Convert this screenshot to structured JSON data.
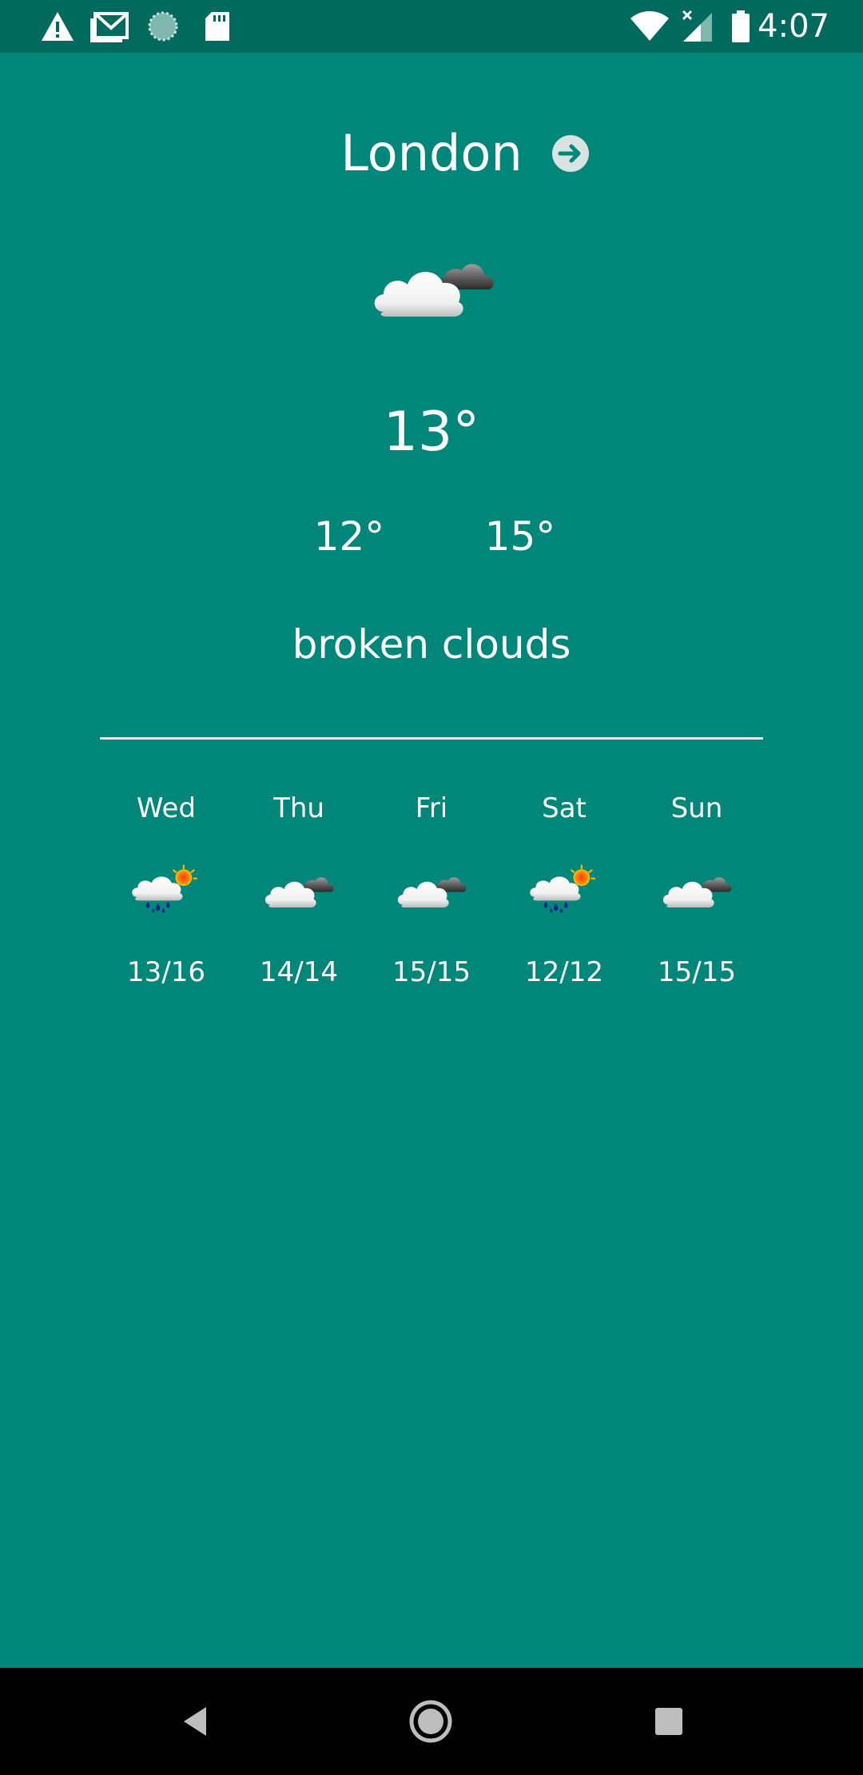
{
  "status_bar": {
    "time": "4:07",
    "left_icons": [
      "warning-icon",
      "gmail-icon",
      "sync-icon",
      "sd-card-icon"
    ],
    "right_icons": [
      "wifi-icon",
      "signal-icon",
      "battery-icon"
    ]
  },
  "weather": {
    "city": "London",
    "current_temp": "13°",
    "min_temp": "12°",
    "max_temp": "15°",
    "description": "broken clouds",
    "current_icon": "broken-clouds-icon"
  },
  "forecast": [
    {
      "day": "Wed",
      "range": "13/16",
      "icon": "rain-sun-icon"
    },
    {
      "day": "Thu",
      "range": "14/14",
      "icon": "broken-clouds-icon"
    },
    {
      "day": "Fri",
      "range": "15/15",
      "icon": "broken-clouds-icon"
    },
    {
      "day": "Sat",
      "range": "12/12",
      "icon": "rain-sun-icon"
    },
    {
      "day": "Sun",
      "range": "15/15",
      "icon": "broken-clouds-icon"
    }
  ],
  "colors": {
    "background": "#00877A",
    "status_bar": "#006A5E",
    "nav_bar": "#000000"
  }
}
